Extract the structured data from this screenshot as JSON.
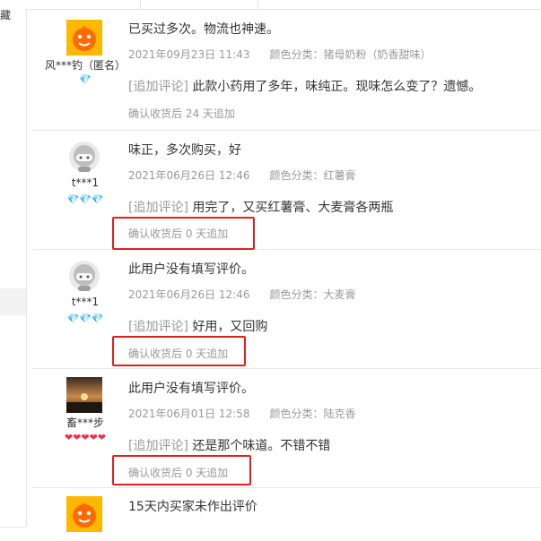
{
  "sidebar": {
    "partial_label": "藏"
  },
  "reviews": [
    {
      "user": "风***钓（匿名）",
      "badges": "💎",
      "content": "已买过多次。物流也神速。",
      "date": "2021年09月23日 11:43",
      "sku": "颜色分类：猪母奶粉（奶香甜味）",
      "append_tag": "[追加评论]",
      "append_text": "此款小药用了多年，味纯正。现味怎么变了？遗憾。",
      "after": "确认收货后 24 天追加"
    },
    {
      "user": "t***1",
      "badges": "💎💎💎",
      "content": "味正，多次购买，好",
      "date": "2021年06月26日 12:46",
      "sku": "颜色分类：红薯膏",
      "append_tag": "[追加评论]",
      "append_text": "用完了，又买红薯膏、大麦膏各两瓶",
      "after": "确认收货后 0 天追加"
    },
    {
      "user": "t***1",
      "badges": "💎💎💎",
      "content": "此用户没有填写评价。",
      "date": "2021年06月26日 12:46",
      "sku": "颜色分类：大麦膏",
      "append_tag": "[追加评论]",
      "append_text": "好用，又回购",
      "after": "确认收货后 0 天追加"
    },
    {
      "user": "畜***步",
      "badges": "❤❤❤❤❤",
      "content": "此用户没有填写评价。",
      "date": "2021年06月01日 12:58",
      "sku": "颜色分类：陆克香",
      "append_tag": "[追加评论]",
      "append_text": "还是那个味道。不错不错",
      "after": "确认收货后 0 天追加"
    },
    {
      "content": "15天内买家未作出评价"
    }
  ],
  "colors": {
    "highlight": "#e02020",
    "diamond": "#3fa9f5",
    "heart": "#e8344e",
    "meta": "#999999"
  },
  "icons": {
    "avatar_default": "orange-mascot-avatar-icon",
    "avatar_gray": "gray-helmet-avatar-icon",
    "avatar_photo": "sunset-photo-avatar-icon",
    "badge_diamond": "diamond-icon",
    "badge_heart": "heart-icon"
  }
}
